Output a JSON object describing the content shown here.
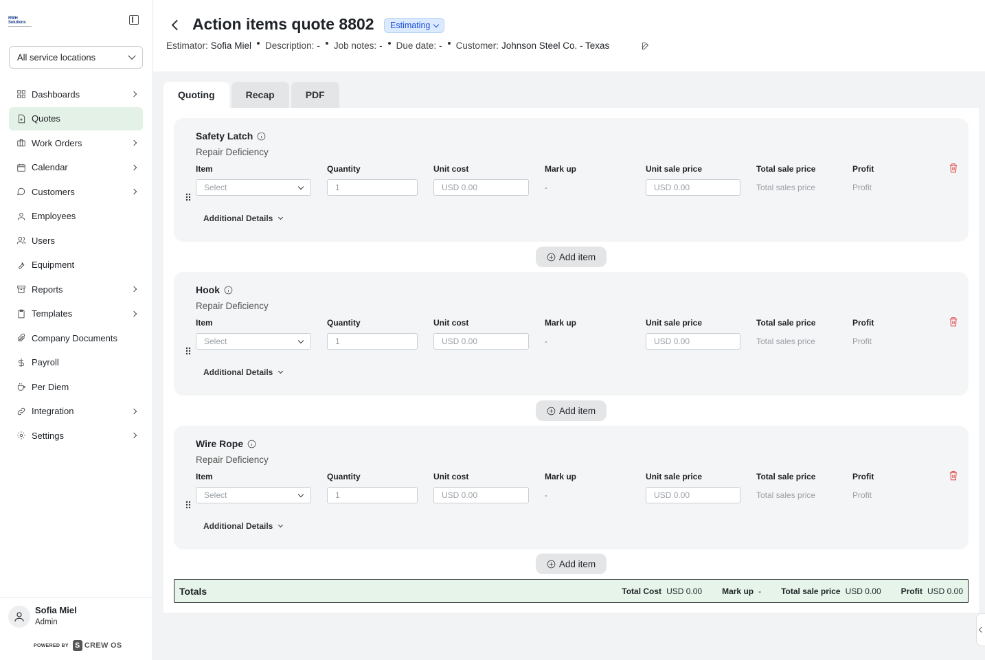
{
  "sidebar": {
    "logo_text": "RWH Solutions",
    "location_select": "All service locations",
    "nav": [
      {
        "label": "Dashboards",
        "icon": "grid-icon",
        "chevron": true,
        "active": false
      },
      {
        "label": "Quotes",
        "icon": "file-plus-icon",
        "chevron": false,
        "active": true
      },
      {
        "label": "Work Orders",
        "icon": "briefcase-icon",
        "chevron": true,
        "active": false
      },
      {
        "label": "Calendar",
        "icon": "calendar-icon",
        "chevron": true,
        "active": false
      },
      {
        "label": "Customers",
        "icon": "chat-icon",
        "chevron": true,
        "active": false
      },
      {
        "label": "Employees",
        "icon": "person-icon",
        "chevron": false,
        "active": false
      },
      {
        "label": "Users",
        "icon": "users-icon",
        "chevron": false,
        "active": false
      },
      {
        "label": "Equipment",
        "icon": "wrench-icon",
        "chevron": false,
        "active": false
      },
      {
        "label": "Reports",
        "icon": "archive-icon",
        "chevron": true,
        "active": false
      },
      {
        "label": "Templates",
        "icon": "clipboard-icon",
        "chevron": true,
        "active": false
      },
      {
        "label": "Company Documents",
        "icon": "paperclip-icon",
        "chevron": false,
        "active": false
      },
      {
        "label": "Payroll",
        "icon": "dollar-icon",
        "chevron": false,
        "active": false
      },
      {
        "label": "Per Diem",
        "icon": "coffee-icon",
        "chevron": false,
        "active": false
      },
      {
        "label": "Integration",
        "icon": "link-icon",
        "chevron": true,
        "active": false
      },
      {
        "label": "Settings",
        "icon": "gear-icon",
        "chevron": true,
        "active": false
      }
    ],
    "user": {
      "name": "Sofia Miel",
      "role": "Admin"
    },
    "powered_by": "POWERED BY",
    "brand": "CREW OS"
  },
  "header": {
    "title": "Action items quote 8802",
    "status": "Estimating",
    "meta": [
      {
        "key": "Estimator:",
        "value": "Sofia Miel"
      },
      {
        "key": "Description:",
        "value": "-"
      },
      {
        "key": "Job notes:",
        "value": "-"
      },
      {
        "key": "Due date:",
        "value": "-"
      },
      {
        "key": "Customer:",
        "value": "Johnson Steel Co. - Texas"
      }
    ]
  },
  "tabs": [
    {
      "label": "Quoting",
      "active": true
    },
    {
      "label": "Recap",
      "active": false
    },
    {
      "label": "PDF",
      "active": false
    }
  ],
  "columns": {
    "item": "Item",
    "quantity": "Quantity",
    "unit_cost": "Unit cost",
    "mark_up": "Mark up",
    "unit_sale_price": "Unit sale price",
    "total_sale_price": "Total sale price",
    "profit": "Profit"
  },
  "row_defaults": {
    "item_placeholder": "Select",
    "quantity": "1",
    "unit_cost": "USD 0.00",
    "mark_up": "-",
    "unit_sale_price": "USD 0.00",
    "total_sale_price": "Total sales price",
    "profit": "Profit",
    "additional_details": "Additional Details"
  },
  "sections": [
    {
      "title": "Safety Latch",
      "subtitle": "Repair Deficiency"
    },
    {
      "title": "Hook",
      "subtitle": "Repair Deficiency"
    },
    {
      "title": "Wire Rope",
      "subtitle": "Repair Deficiency"
    }
  ],
  "add_item_label": "Add item",
  "totals": {
    "label": "Totals",
    "total_cost_label": "Total Cost",
    "total_cost": "USD 0.00",
    "mark_up_label": "Mark up",
    "mark_up": "-",
    "total_sale_price_label": "Total sale price",
    "total_sale_price": "USD 0.00",
    "profit_label": "Profit",
    "profit": "USD 0.00"
  },
  "colors": {
    "accent_active": "#e4f1e6",
    "status_blue": "#1d4ed8",
    "danger": "#dc2626"
  }
}
